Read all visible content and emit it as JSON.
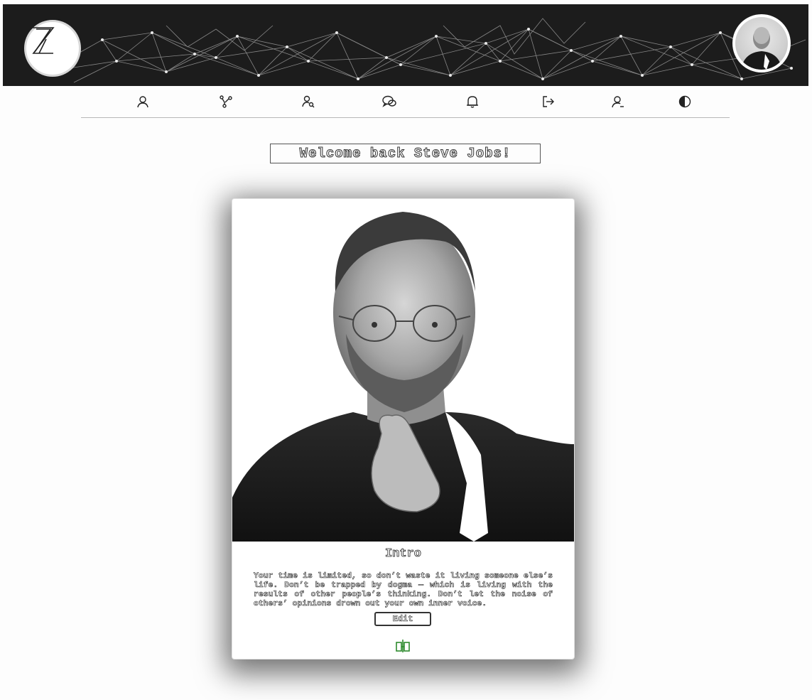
{
  "header": {
    "logo_icon": "z-logo-icon",
    "avatar_icon": "profile-avatar"
  },
  "nav": {
    "items": [
      {
        "icon": "user-icon"
      },
      {
        "icon": "network-icon"
      },
      {
        "icon": "user-search-icon"
      },
      {
        "icon": "chat-icon"
      },
      {
        "icon": "bell-icon"
      },
      {
        "icon": "logout-icon"
      },
      {
        "icon": "user-remove-icon"
      },
      {
        "icon": "contrast-icon"
      }
    ]
  },
  "welcome": {
    "text": "Welcome back Steve Jobs!"
  },
  "card": {
    "title": "Intro",
    "text": "Your time is limited, so don’t waste it living someone else’s life. Don’t be trapped by dogma — which is living with the results of other people’s thinking. Don’t let the noise of others’ opinions drown out your own inner voice.",
    "edit_label": "Edit",
    "bottom_icon": "relationship-icon",
    "bottom_icon_color": "#2e8b2e"
  }
}
